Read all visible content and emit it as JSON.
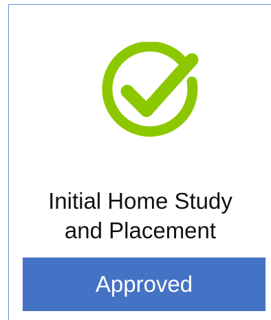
{
  "card": {
    "icon": "checkmark-circle-icon",
    "title_line1": "Initial Home Study",
    "title_line2": "and Placement",
    "status": "Approved"
  },
  "colors": {
    "check_green": "#8cc800",
    "status_blue": "#4472c4",
    "border_blue": "#5b8fd6"
  }
}
